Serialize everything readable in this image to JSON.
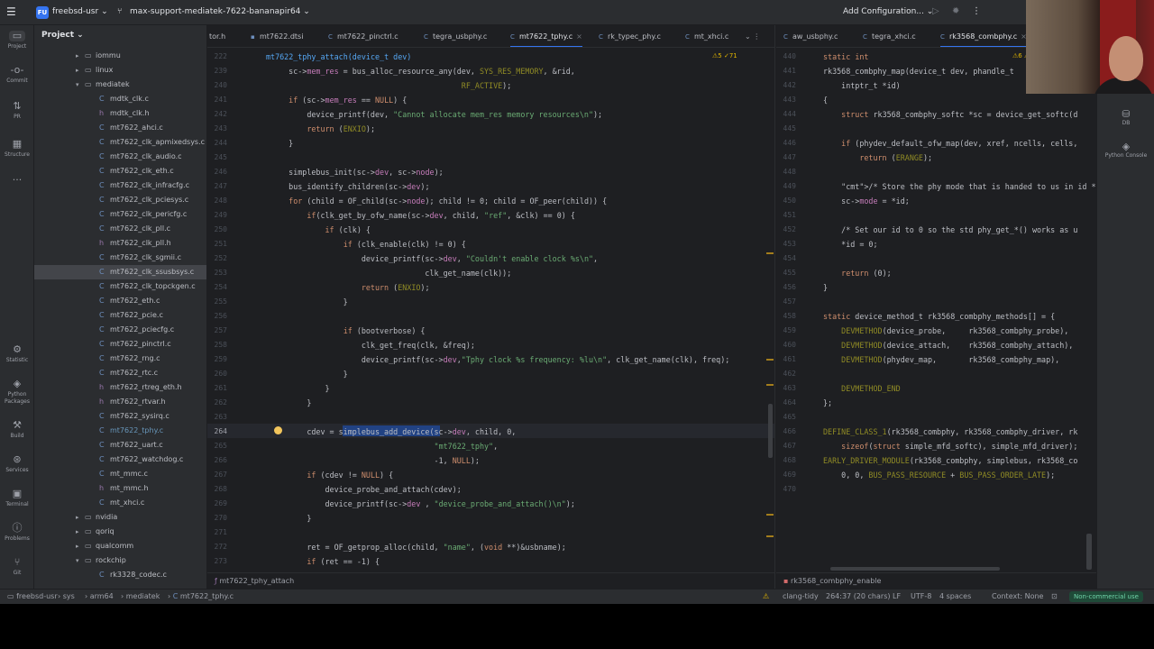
{
  "titlebar": {
    "project_badge": "FU",
    "project_name": "freebsd-usr",
    "branch": "max-support-mediatek-7622-bananapir64",
    "add_configuration": "Add Configuration..."
  },
  "left_tools": [
    {
      "label": "Project",
      "icon": "folder-icon"
    },
    {
      "label": "Commit",
      "icon": "commit-icon"
    },
    {
      "label": "PR",
      "icon": "pull-request-icon"
    },
    {
      "label": "Structure",
      "icon": "structure-icon"
    },
    {
      "label": "",
      "icon": "more-icon"
    },
    {
      "label": "Statistic",
      "icon": "statistic-icon"
    },
    {
      "label": "Python Packages",
      "icon": "python-packages-icon"
    },
    {
      "label": "Build",
      "icon": "build-icon"
    },
    {
      "label": "Services",
      "icon": "services-icon"
    },
    {
      "label": "Terminal",
      "icon": "terminal-icon"
    },
    {
      "label": "Problems",
      "icon": "problems-icon"
    },
    {
      "label": "Git",
      "icon": "git-icon"
    }
  ],
  "right_tools": [
    {
      "label": "DB",
      "icon": "database-icon"
    },
    {
      "label": "Python Console",
      "icon": "python-console-icon"
    }
  ],
  "project_panel": {
    "title": "Project",
    "tree": [
      {
        "name": "iommu",
        "type": "folder",
        "depth": 1,
        "arrow": "▸"
      },
      {
        "name": "linux",
        "type": "folder",
        "depth": 1,
        "arrow": "▸"
      },
      {
        "name": "mediatek",
        "type": "folder",
        "depth": 1,
        "arrow": "▾"
      },
      {
        "name": "mdtk_clk.c",
        "type": "c",
        "depth": 2
      },
      {
        "name": "mdtk_clk.h",
        "type": "h",
        "depth": 2
      },
      {
        "name": "mt7622_ahci.c",
        "type": "c",
        "depth": 2
      },
      {
        "name": "mt7622_clk_apmixedsys.c",
        "type": "c",
        "depth": 2
      },
      {
        "name": "mt7622_clk_audio.c",
        "type": "c",
        "depth": 2
      },
      {
        "name": "mt7622_clk_eth.c",
        "type": "c",
        "depth": 2
      },
      {
        "name": "mt7622_clk_infracfg.c",
        "type": "c",
        "depth": 2
      },
      {
        "name": "mt7622_clk_pciesys.c",
        "type": "c",
        "depth": 2
      },
      {
        "name": "mt7622_clk_pericfg.c",
        "type": "c",
        "depth": 2
      },
      {
        "name": "mt7622_clk_pll.c",
        "type": "c",
        "depth": 2
      },
      {
        "name": "mt7622_clk_pll.h",
        "type": "h",
        "depth": 2
      },
      {
        "name": "mt7622_clk_sgmii.c",
        "type": "c",
        "depth": 2
      },
      {
        "name": "mt7622_clk_ssusbsys.c",
        "type": "c",
        "depth": 2,
        "selected": true
      },
      {
        "name": "mt7622_clk_topckgen.c",
        "type": "c",
        "depth": 2
      },
      {
        "name": "mt7622_eth.c",
        "type": "c",
        "depth": 2
      },
      {
        "name": "mt7622_pcie.c",
        "type": "c",
        "depth": 2
      },
      {
        "name": "mt7622_pciecfg.c",
        "type": "c",
        "depth": 2
      },
      {
        "name": "mt7622_pinctrl.c",
        "type": "c",
        "depth": 2
      },
      {
        "name": "mt7622_rng.c",
        "type": "c",
        "depth": 2
      },
      {
        "name": "mt7622_rtc.c",
        "type": "c",
        "depth": 2
      },
      {
        "name": "mt7622_rtreg_eth.h",
        "type": "h",
        "depth": 2
      },
      {
        "name": "mt7622_rtvar.h",
        "type": "h",
        "depth": 2
      },
      {
        "name": "mt7622_sysirq.c",
        "type": "c",
        "depth": 2
      },
      {
        "name": "mt7622_tphy.c",
        "type": "c",
        "depth": 2,
        "modified": true
      },
      {
        "name": "mt7622_uart.c",
        "type": "c",
        "depth": 2
      },
      {
        "name": "mt7622_watchdog.c",
        "type": "c",
        "depth": 2
      },
      {
        "name": "mt_mmc.c",
        "type": "c",
        "depth": 2
      },
      {
        "name": "mt_mmc.h",
        "type": "h",
        "depth": 2
      },
      {
        "name": "mt_xhci.c",
        "type": "c",
        "depth": 2
      },
      {
        "name": "nvidia",
        "type": "folder",
        "depth": 1,
        "arrow": "▸"
      },
      {
        "name": "qoriq",
        "type": "folder",
        "depth": 1,
        "arrow": "▸"
      },
      {
        "name": "qualcomm",
        "type": "folder",
        "depth": 1,
        "arrow": "▸"
      },
      {
        "name": "rockchip",
        "type": "folder",
        "depth": 1,
        "arrow": "▾"
      },
      {
        "name": "rk3328_codec.c",
        "type": "c",
        "depth": 2
      }
    ]
  },
  "editor_left": {
    "tabs": [
      {
        "label": "tor.h",
        "active": false
      },
      {
        "label": "mt7622.dtsi",
        "active": false
      },
      {
        "label": "mt7622_pinctrl.c",
        "active": false
      },
      {
        "label": "tegra_usbphy.c",
        "active": false
      },
      {
        "label": "mt7622_tphy.c",
        "active": true
      },
      {
        "label": "rk_typec_phy.c",
        "active": false
      },
      {
        "label": "mt_xhci.c",
        "active": false
      }
    ],
    "sticky_header": "mt7622_tphy_attach(device_t dev)",
    "sticky_line": "222",
    "warnings": "⚠5 ✓71",
    "breadcrumb": "mt7622_tphy_attach",
    "current_line": "264",
    "lines": [
      {
        "n": "239",
        "html": "    sc->mem_res = bus_alloc_resource_any(dev, SYS_RES_MEMORY, &rid,"
      },
      {
        "n": "240",
        "html": "                                          RF_ACTIVE);"
      },
      {
        "n": "241",
        "html": "    if (sc->mem_res == NULL) {"
      },
      {
        "n": "242",
        "html": "        device_printf(dev, \"Cannot allocate mem_res memory resources\\n\");"
      },
      {
        "n": "243",
        "html": "        return (ENXIO);"
      },
      {
        "n": "244",
        "html": "    }"
      },
      {
        "n": "245",
        "html": ""
      },
      {
        "n": "246",
        "html": "    simplebus_init(sc->dev, sc->node);"
      },
      {
        "n": "247",
        "html": "    bus_identify_children(sc->dev);"
      },
      {
        "n": "248",
        "html": "    for (child = OF_child(sc->node); child != 0; child = OF_peer(child)) {"
      },
      {
        "n": "249",
        "html": "        if(clk_get_by_ofw_name(sc->dev, child, \"ref\", &clk) == 0) {"
      },
      {
        "n": "250",
        "html": "            if (clk) {"
      },
      {
        "n": "251",
        "html": "                if (clk_enable(clk) != 0) {"
      },
      {
        "n": "252",
        "html": "                    device_printf(sc->dev, \"Couldn't enable clock %s\\n\","
      },
      {
        "n": "253",
        "html": "                                  clk_get_name(clk));"
      },
      {
        "n": "254",
        "html": "                    return (ENXIO);"
      },
      {
        "n": "255",
        "html": "                }"
      },
      {
        "n": "256",
        "html": ""
      },
      {
        "n": "257",
        "html": "                if (bootverbose) {"
      },
      {
        "n": "258",
        "html": "                    clk_get_freq(clk, &freq);"
      },
      {
        "n": "259",
        "html": "                    device_printf(sc->dev,\"Tphy clock %s frequency: %lu\\n\", clk_get_name(clk), freq);"
      },
      {
        "n": "260",
        "html": "                }"
      },
      {
        "n": "261",
        "html": "            }"
      },
      {
        "n": "262",
        "html": "        }"
      },
      {
        "n": "263",
        "html": ""
      },
      {
        "n": "264",
        "html": "        cdev = simplebus_add_device(sc->dev, child, 0,"
      },
      {
        "n": "265",
        "html": "                                    \"mt7622_tphy\","
      },
      {
        "n": "266",
        "html": "                                    -1, NULL);"
      },
      {
        "n": "267",
        "html": "        if (cdev != NULL) {"
      },
      {
        "n": "268",
        "html": "            device_probe_and_attach(cdev);"
      },
      {
        "n": "269",
        "html": "            device_printf(sc->dev , \"device_probe_and_attach()\\n\");"
      },
      {
        "n": "270",
        "html": "        }"
      },
      {
        "n": "271",
        "html": ""
      },
      {
        "n": "272",
        "html": "        ret = OF_getprop_alloc(child, \"name\", (void **)&usbname);"
      },
      {
        "n": "273",
        "html": "        if (ret == -1) {"
      }
    ]
  },
  "editor_right": {
    "tabs": [
      {
        "label": "aw_usbphy.c",
        "active": false
      },
      {
        "label": "tegra_xhci.c",
        "active": false
      },
      {
        "label": "rk3568_combphy.c",
        "active": true
      }
    ],
    "warnings": "⚠6 ⚠2",
    "breadcrumb": "rk3568_combphy_enable",
    "lines": [
      {
        "n": "440",
        "html": "static int"
      },
      {
        "n": "441",
        "html": "rk3568_combphy_map(device_t dev, phandle_t"
      },
      {
        "n": "442",
        "html": "    intptr_t *id)"
      },
      {
        "n": "443",
        "html": "{"
      },
      {
        "n": "444",
        "html": "    struct rk3568_combphy_softc *sc = device_get_softc(d"
      },
      {
        "n": "445",
        "html": ""
      },
      {
        "n": "446",
        "html": "    if (phydev_default_ofw_map(dev, xref, ncells, cells,"
      },
      {
        "n": "447",
        "html": "        return (ERANGE);"
      },
      {
        "n": "448",
        "html": ""
      },
      {
        "n": "449",
        "html": "    /* Store the phy mode that is handed to us in id */"
      },
      {
        "n": "450",
        "html": "    sc->mode = *id;"
      },
      {
        "n": "451",
        "html": ""
      },
      {
        "n": "452",
        "html": "    /* Set our id to 0 so the std phy_get_*() works as u"
      },
      {
        "n": "453",
        "html": "    *id = 0;"
      },
      {
        "n": "454",
        "html": ""
      },
      {
        "n": "455",
        "html": "    return (0);"
      },
      {
        "n": "456",
        "html": "}"
      },
      {
        "n": "457",
        "html": ""
      },
      {
        "n": "458",
        "html": "static device_method_t rk3568_combphy_methods[] = {"
      },
      {
        "n": "459",
        "html": "    DEVMETHOD(device_probe,     rk3568_combphy_probe),"
      },
      {
        "n": "460",
        "html": "    DEVMETHOD(device_attach,    rk3568_combphy_attach),"
      },
      {
        "n": "461",
        "html": "    DEVMETHOD(phydev_map,       rk3568_combphy_map),"
      },
      {
        "n": "462",
        "html": ""
      },
      {
        "n": "463",
        "html": "    DEVMETHOD_END"
      },
      {
        "n": "464",
        "html": "};"
      },
      {
        "n": "465",
        "html": ""
      },
      {
        "n": "466",
        "html": "DEFINE_CLASS_1(rk3568_combphy, rk3568_combphy_driver, rk"
      },
      {
        "n": "467",
        "html": "    sizeof(struct simple_mfd_softc), simple_mfd_driver);"
      },
      {
        "n": "468",
        "html": "EARLY_DRIVER_MODULE(rk3568_combphy, simplebus, rk3568_co"
      },
      {
        "n": "469",
        "html": "    0, 0, BUS_PASS_RESOURCE + BUS_PASS_ORDER_LATE);"
      },
      {
        "n": "470",
        "html": ""
      }
    ]
  },
  "statusbar": {
    "path": [
      "freebsd-usr",
      "sys",
      "arm64",
      "mediatek",
      "mt7622_tphy.c"
    ],
    "clang": "clang-tidy",
    "position": "264:37 (20 chars)",
    "line_sep": "LF",
    "encoding": "UTF-8",
    "indent": "4 spaces",
    "context": "Context: None",
    "license": "Non-commercial use"
  },
  "colors": {
    "accent": "#3574f0",
    "bg_editor": "#1e1f22",
    "bg_panel": "#2b2d30",
    "selection": "#214283",
    "license_badge": "#1f4a38"
  }
}
